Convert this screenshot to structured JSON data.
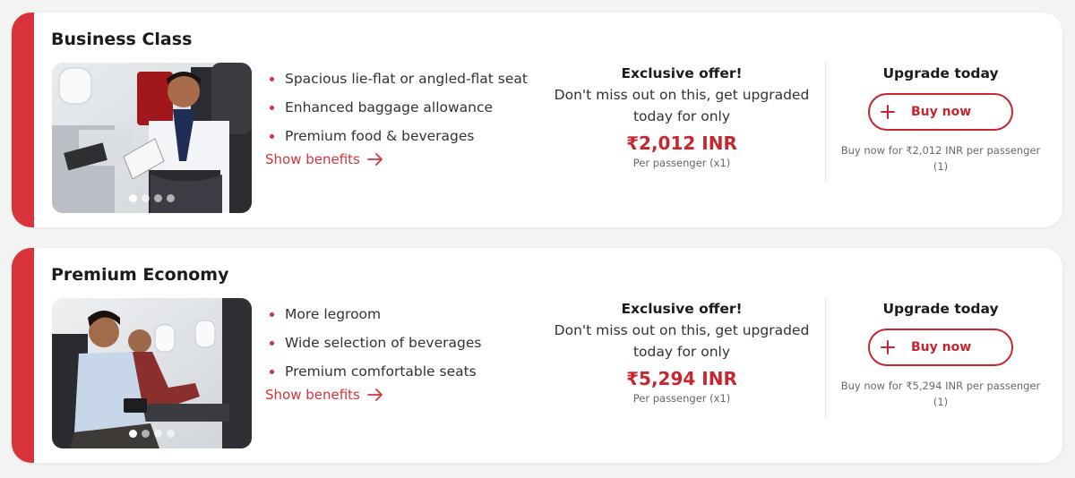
{
  "colors": {
    "accent": "#d8323a",
    "price": "#c8262e"
  },
  "cards": [
    {
      "title": "Business Class",
      "image_alt": "business-class-seat-photo",
      "carousel_dots": 4,
      "features": [
        "Spacious lie-flat or angled-flat seat",
        "Enhanced baggage allowance",
        "Premium food & beverages"
      ],
      "benefits_link": "Show benefits",
      "offer_heading": "Exclusive offer!",
      "offer_text": "Don't miss out on this, get upgraded today for only",
      "price": "₹2,012 INR",
      "price_note": "Per passenger (x1)",
      "upgrade_heading": "Upgrade today",
      "buy_label": "Buy now",
      "buy_note": "Buy now for ₹2,012 INR per passenger (1)"
    },
    {
      "title": "Premium Economy",
      "image_alt": "premium-economy-seat-photo",
      "carousel_dots": 4,
      "features": [
        "More legroom",
        "Wide selection of beverages",
        "Premium comfortable seats"
      ],
      "benefits_link": "Show benefits",
      "offer_heading": "Exclusive offer!",
      "offer_text": "Don't miss out on this, get upgraded today for only",
      "price": "₹5,294 INR",
      "price_note": "Per passenger (x1)",
      "upgrade_heading": "Upgrade today",
      "buy_label": "Buy now",
      "buy_note": "Buy now for ₹5,294 INR per passenger (1)"
    }
  ]
}
